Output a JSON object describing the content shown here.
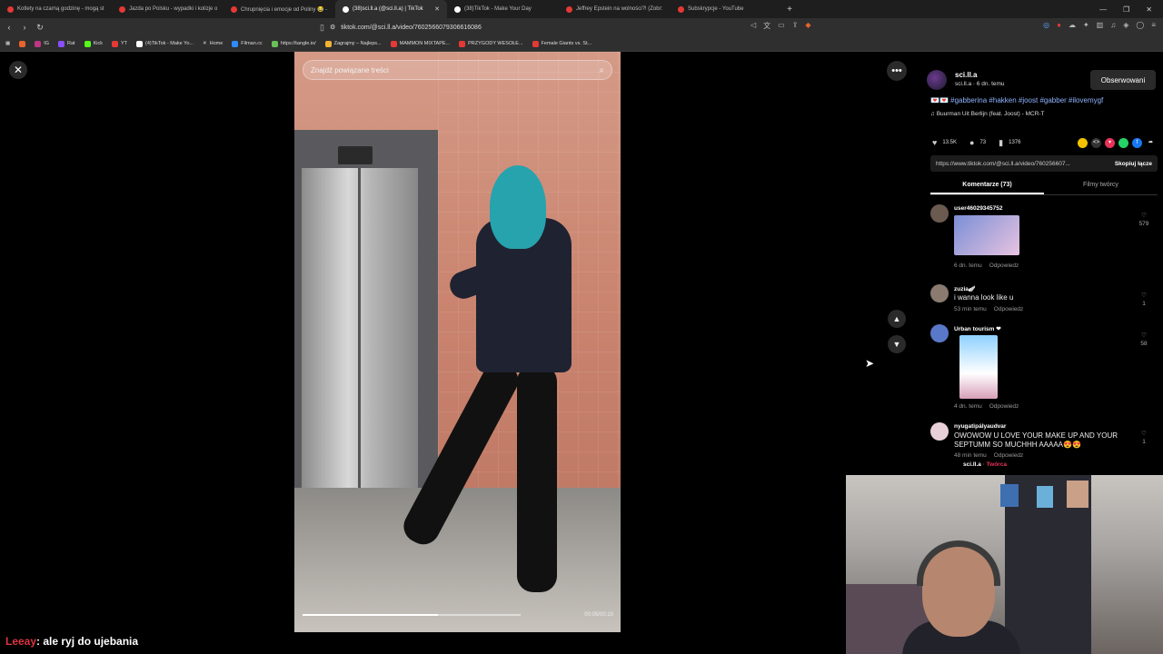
{
  "tabs": [
    {
      "title": "Kotlety na czarną godzinę - mogą st",
      "icon": "youtube-icon"
    },
    {
      "title": "Jazda po Polsku - wypadki i kolizje o",
      "icon": "youtube-icon"
    },
    {
      "title": "Chrupnięcia i emocje od Poliny 😂 -",
      "icon": "youtube-icon"
    },
    {
      "title": "(38)sci.ll.a (@sci.ll.a) | TikTok",
      "icon": "tiktok-icon",
      "active": true
    },
    {
      "title": "(38)TikTok - Make Your Day",
      "icon": "tiktok-icon"
    },
    {
      "title": "Jeffrey Epstein na wolności?! (Zobr:",
      "icon": "youtube-icon"
    },
    {
      "title": "Subskrypcje - YouTube",
      "icon": "youtube-icon"
    }
  ],
  "address": {
    "url": "tiktok.com/@sci.ll.a/video/7602566079306616086"
  },
  "bookmarks": [
    "IG",
    "Rat",
    "Kick",
    "YT",
    "(4)TikTok - Make Yo...",
    "Home",
    "Filman.cc",
    "https://tangle.io/",
    "Zagrajmy – Najleps...",
    "MAMMON MIXTAPE...",
    "PRZYGODY WESOŁE...",
    "Female Giants vs. St..."
  ],
  "video": {
    "search_placeholder": "Znajdź powiązane treści",
    "progress_fraction": 0.62,
    "time": "00:05/00:10"
  },
  "author": {
    "name": "sci.ll.a",
    "sub": "sci.ll.a · 6 dn. temu",
    "follow_label": "Obserwowani"
  },
  "caption": {
    "emoji": "💌💌",
    "hashtags": "#gabberina #hakken #joost #gabber #ilovemygf"
  },
  "music": "Buurman Uit Berlijn (feat. Joost) - MCR-T",
  "stats": {
    "likes": "13.5K",
    "comments": "73",
    "saves": "1376"
  },
  "link": {
    "url": "https://www.tiktok.com/@sci.ll.a/video/760256607...",
    "copy_label": "Skopiuj łącze"
  },
  "panel_tabs": {
    "comments": "Komentarze (73)",
    "creator_videos": "Filmy twórcy"
  },
  "comments": [
    {
      "user": "user46029345752",
      "text": "",
      "time": "6 dn. temu",
      "reply": "Odpowiedz",
      "likes": "579"
    },
    {
      "user": "zuzia🪽",
      "text": "i wanna look like u",
      "time": "53 min temu",
      "reply": "Odpowiedz",
      "likes": "1"
    },
    {
      "user": "Urban tourism ❤",
      "text": "",
      "time": "4 dn. temu",
      "reply": "Odpowiedz",
      "likes": "58"
    },
    {
      "user": "nyugatipályaudvar",
      "text": "OWOWOW U LOVE YOUR MAKE UP AND YOUR SEPTUMM SO MUCHHH AAAAA😍😍",
      "time": "48 min temu",
      "reply": "Odpowiedz",
      "likes": "1"
    }
  ],
  "reply_preview": {
    "user": "sci.ll.a",
    "badge": "· Twórca"
  },
  "chat": {
    "user": "Leeay",
    "message": ": ale ryj do ujebania"
  },
  "colors": {
    "accent_red": "#d9353f",
    "hashtag_blue": "#8fb4ff"
  }
}
